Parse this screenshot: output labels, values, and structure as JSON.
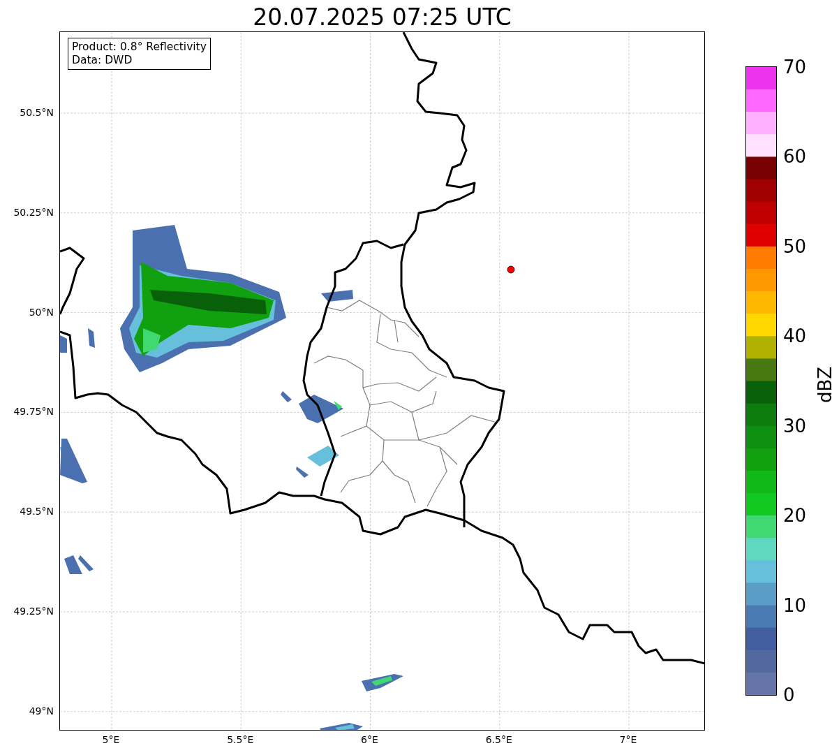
{
  "title": "20.07.2025 07:25 UTC",
  "info_box": [
    "Product: 0.8° Reflectivity",
    "Data: DWD"
  ],
  "map": {
    "y_ticks": [
      "50.5°N",
      "50.25°N",
      "50°N",
      "49.75°N",
      "49.5°N",
      "49.25°N",
      "49°N"
    ],
    "x_ticks": [
      "5°E",
      "5.5°E",
      "6°E",
      "6.5°E",
      "7°E"
    ]
  },
  "colorbar": {
    "label": "dBZ",
    "ticks": [
      "70",
      "60",
      "50",
      "40",
      "30",
      "20",
      "10",
      "0"
    ],
    "bins": [
      {
        "color": "#ee33ee"
      },
      {
        "color": "#ff66ff"
      },
      {
        "color": "#ffb0ff"
      },
      {
        "color": "#ffe0ff"
      },
      {
        "color": "#780000"
      },
      {
        "color": "#a00000"
      },
      {
        "color": "#c00000"
      },
      {
        "color": "#e00000"
      },
      {
        "color": "#ff7c00"
      },
      {
        "color": "#ff9800"
      },
      {
        "color": "#ffb800"
      },
      {
        "color": "#ffd800"
      },
      {
        "color": "#b0b000"
      },
      {
        "color": "#487810"
      },
      {
        "color": "#086008"
      },
      {
        "color": "#0c7c0c"
      },
      {
        "color": "#109010"
      },
      {
        "color": "#10a010"
      },
      {
        "color": "#10b818"
      },
      {
        "color": "#10c820"
      },
      {
        "color": "#40d870"
      },
      {
        "color": "#60d8c0"
      },
      {
        "color": "#66c0dc"
      },
      {
        "color": "#5a9ec8"
      },
      {
        "color": "#4a7ab2"
      },
      {
        "color": "#425ea0"
      },
      {
        "color": "#5468a0"
      },
      {
        "color": "#6474a8"
      }
    ]
  }
}
